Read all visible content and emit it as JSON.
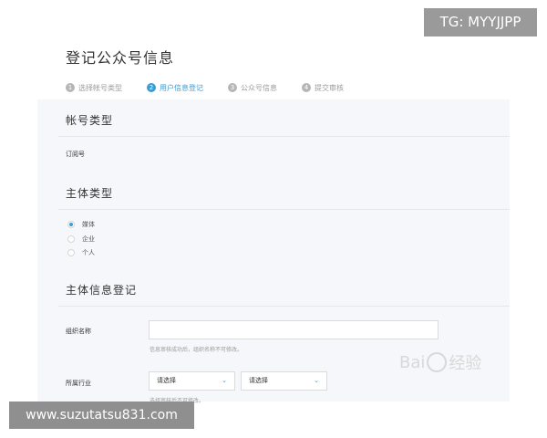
{
  "watermarks": {
    "tg": "TG: MYYJJPP",
    "url": "www.suzutatsu831.com",
    "baidu": "Bai\u0000经验"
  },
  "page": {
    "title": "登记公众号信息"
  },
  "steps": [
    {
      "num": "1",
      "label": "选择帐号类型",
      "active": false
    },
    {
      "num": "2",
      "label": "用户信息登记",
      "active": true
    },
    {
      "num": "3",
      "label": "公众号信息",
      "active": false
    },
    {
      "num": "4",
      "label": "提交审核",
      "active": false
    }
  ],
  "account_type": {
    "title": "帐号类型",
    "value": "订阅号"
  },
  "subject_type": {
    "title": "主体类型",
    "options": [
      {
        "label": "媒体",
        "checked": true
      },
      {
        "label": "企业",
        "checked": false
      },
      {
        "label": "个人",
        "checked": false
      }
    ]
  },
  "subject_info": {
    "title": "主体信息登记",
    "org_name_label": "组织名称",
    "org_name_value": "",
    "org_name_hint": "信息审核成功后，组织名称不可修改。",
    "industry_label": "所属行业",
    "industry_select_1": "请选择",
    "industry_select_2": "请选择",
    "industry_hint": "选择审核后不可修改。"
  },
  "colors": {
    "accent": "#3a9bd5",
    "panel_bg": "#f6f7fa"
  }
}
